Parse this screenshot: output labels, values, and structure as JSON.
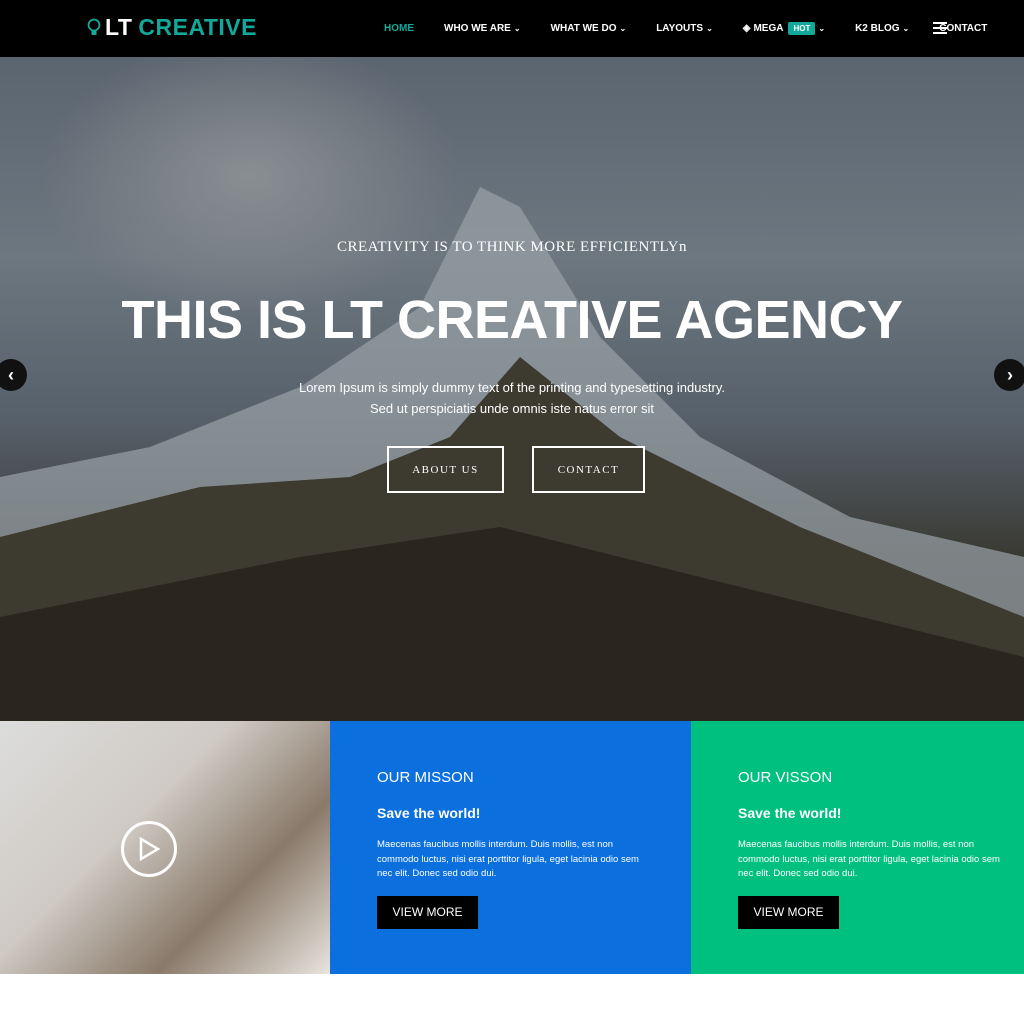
{
  "header": {
    "logo_prefix": "LT",
    "logo_accent": "CREATIVE",
    "nav": [
      {
        "label": "HOME",
        "active": true
      },
      {
        "label": "WHO WE ARE",
        "dropdown": true
      },
      {
        "label": "WHAT WE DO",
        "dropdown": true
      },
      {
        "label": "LAYOUTS",
        "dropdown": true
      },
      {
        "label": "MEGA",
        "badge": "HOT",
        "dropdown": true
      },
      {
        "label": "K2 BLOG",
        "dropdown": true
      },
      {
        "label": "CONTACT"
      }
    ]
  },
  "hero": {
    "tagline": "CREATIVITY IS TO THINK MORE EFFICIENTLYn",
    "title": "THIS IS LT CREATIVE AGENCY",
    "desc_line1": "Lorem Ipsum is simply dummy text of the printing and typesetting industry.",
    "desc_line2": "Sed ut perspiciatis unde omnis iste natus error sit",
    "btn_about": "ABOUT US",
    "btn_contact": "CONTACT",
    "prev": "‹",
    "next": "›"
  },
  "panels": [
    {
      "title": "OUR MISSON",
      "subtitle": "Save the world!",
      "text": "Maecenas faucibus mollis interdum. Duis mollis, est non commodo luctus, nisi erat porttitor ligula, eget lacinia odio sem nec elit. Donec sed odio dui.",
      "button": "VIEW MORE",
      "color": "#0b6fde"
    },
    {
      "title": "OUR VISSON",
      "subtitle": "Save the world!",
      "text": "Maecenas faucibus mollis interdum. Duis mollis, est non commodo luctus, nisi erat porttitor ligula, eget lacinia odio sem nec elit. Donec sed odio dui.",
      "button": "VIEW MORE",
      "color": "#00c07f"
    }
  ],
  "colors": {
    "accent": "#12a89a",
    "header_bg": "#000000"
  }
}
